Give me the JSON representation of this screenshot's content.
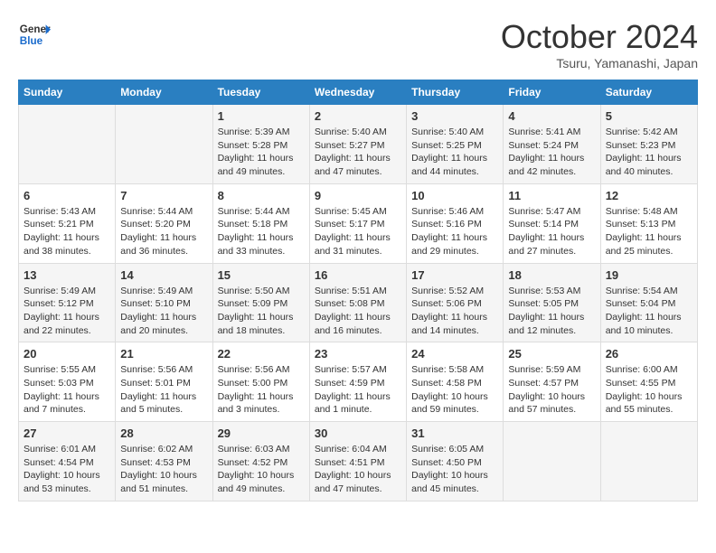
{
  "logo": {
    "line1": "General",
    "line2": "Blue"
  },
  "title": "October 2024",
  "location": "Tsuru, Yamanashi, Japan",
  "days_header": [
    "Sunday",
    "Monday",
    "Tuesday",
    "Wednesday",
    "Thursday",
    "Friday",
    "Saturday"
  ],
  "weeks": [
    [
      {
        "num": "",
        "info": ""
      },
      {
        "num": "",
        "info": ""
      },
      {
        "num": "1",
        "info": "Sunrise: 5:39 AM\nSunset: 5:28 PM\nDaylight: 11 hours and 49 minutes."
      },
      {
        "num": "2",
        "info": "Sunrise: 5:40 AM\nSunset: 5:27 PM\nDaylight: 11 hours and 47 minutes."
      },
      {
        "num": "3",
        "info": "Sunrise: 5:40 AM\nSunset: 5:25 PM\nDaylight: 11 hours and 44 minutes."
      },
      {
        "num": "4",
        "info": "Sunrise: 5:41 AM\nSunset: 5:24 PM\nDaylight: 11 hours and 42 minutes."
      },
      {
        "num": "5",
        "info": "Sunrise: 5:42 AM\nSunset: 5:23 PM\nDaylight: 11 hours and 40 minutes."
      }
    ],
    [
      {
        "num": "6",
        "info": "Sunrise: 5:43 AM\nSunset: 5:21 PM\nDaylight: 11 hours and 38 minutes."
      },
      {
        "num": "7",
        "info": "Sunrise: 5:44 AM\nSunset: 5:20 PM\nDaylight: 11 hours and 36 minutes."
      },
      {
        "num": "8",
        "info": "Sunrise: 5:44 AM\nSunset: 5:18 PM\nDaylight: 11 hours and 33 minutes."
      },
      {
        "num": "9",
        "info": "Sunrise: 5:45 AM\nSunset: 5:17 PM\nDaylight: 11 hours and 31 minutes."
      },
      {
        "num": "10",
        "info": "Sunrise: 5:46 AM\nSunset: 5:16 PM\nDaylight: 11 hours and 29 minutes."
      },
      {
        "num": "11",
        "info": "Sunrise: 5:47 AM\nSunset: 5:14 PM\nDaylight: 11 hours and 27 minutes."
      },
      {
        "num": "12",
        "info": "Sunrise: 5:48 AM\nSunset: 5:13 PM\nDaylight: 11 hours and 25 minutes."
      }
    ],
    [
      {
        "num": "13",
        "info": "Sunrise: 5:49 AM\nSunset: 5:12 PM\nDaylight: 11 hours and 22 minutes."
      },
      {
        "num": "14",
        "info": "Sunrise: 5:49 AM\nSunset: 5:10 PM\nDaylight: 11 hours and 20 minutes."
      },
      {
        "num": "15",
        "info": "Sunrise: 5:50 AM\nSunset: 5:09 PM\nDaylight: 11 hours and 18 minutes."
      },
      {
        "num": "16",
        "info": "Sunrise: 5:51 AM\nSunset: 5:08 PM\nDaylight: 11 hours and 16 minutes."
      },
      {
        "num": "17",
        "info": "Sunrise: 5:52 AM\nSunset: 5:06 PM\nDaylight: 11 hours and 14 minutes."
      },
      {
        "num": "18",
        "info": "Sunrise: 5:53 AM\nSunset: 5:05 PM\nDaylight: 11 hours and 12 minutes."
      },
      {
        "num": "19",
        "info": "Sunrise: 5:54 AM\nSunset: 5:04 PM\nDaylight: 11 hours and 10 minutes."
      }
    ],
    [
      {
        "num": "20",
        "info": "Sunrise: 5:55 AM\nSunset: 5:03 PM\nDaylight: 11 hours and 7 minutes."
      },
      {
        "num": "21",
        "info": "Sunrise: 5:56 AM\nSunset: 5:01 PM\nDaylight: 11 hours and 5 minutes."
      },
      {
        "num": "22",
        "info": "Sunrise: 5:56 AM\nSunset: 5:00 PM\nDaylight: 11 hours and 3 minutes."
      },
      {
        "num": "23",
        "info": "Sunrise: 5:57 AM\nSunset: 4:59 PM\nDaylight: 11 hours and 1 minute."
      },
      {
        "num": "24",
        "info": "Sunrise: 5:58 AM\nSunset: 4:58 PM\nDaylight: 10 hours and 59 minutes."
      },
      {
        "num": "25",
        "info": "Sunrise: 5:59 AM\nSunset: 4:57 PM\nDaylight: 10 hours and 57 minutes."
      },
      {
        "num": "26",
        "info": "Sunrise: 6:00 AM\nSunset: 4:55 PM\nDaylight: 10 hours and 55 minutes."
      }
    ],
    [
      {
        "num": "27",
        "info": "Sunrise: 6:01 AM\nSunset: 4:54 PM\nDaylight: 10 hours and 53 minutes."
      },
      {
        "num": "28",
        "info": "Sunrise: 6:02 AM\nSunset: 4:53 PM\nDaylight: 10 hours and 51 minutes."
      },
      {
        "num": "29",
        "info": "Sunrise: 6:03 AM\nSunset: 4:52 PM\nDaylight: 10 hours and 49 minutes."
      },
      {
        "num": "30",
        "info": "Sunrise: 6:04 AM\nSunset: 4:51 PM\nDaylight: 10 hours and 47 minutes."
      },
      {
        "num": "31",
        "info": "Sunrise: 6:05 AM\nSunset: 4:50 PM\nDaylight: 10 hours and 45 minutes."
      },
      {
        "num": "",
        "info": ""
      },
      {
        "num": "",
        "info": ""
      }
    ]
  ]
}
